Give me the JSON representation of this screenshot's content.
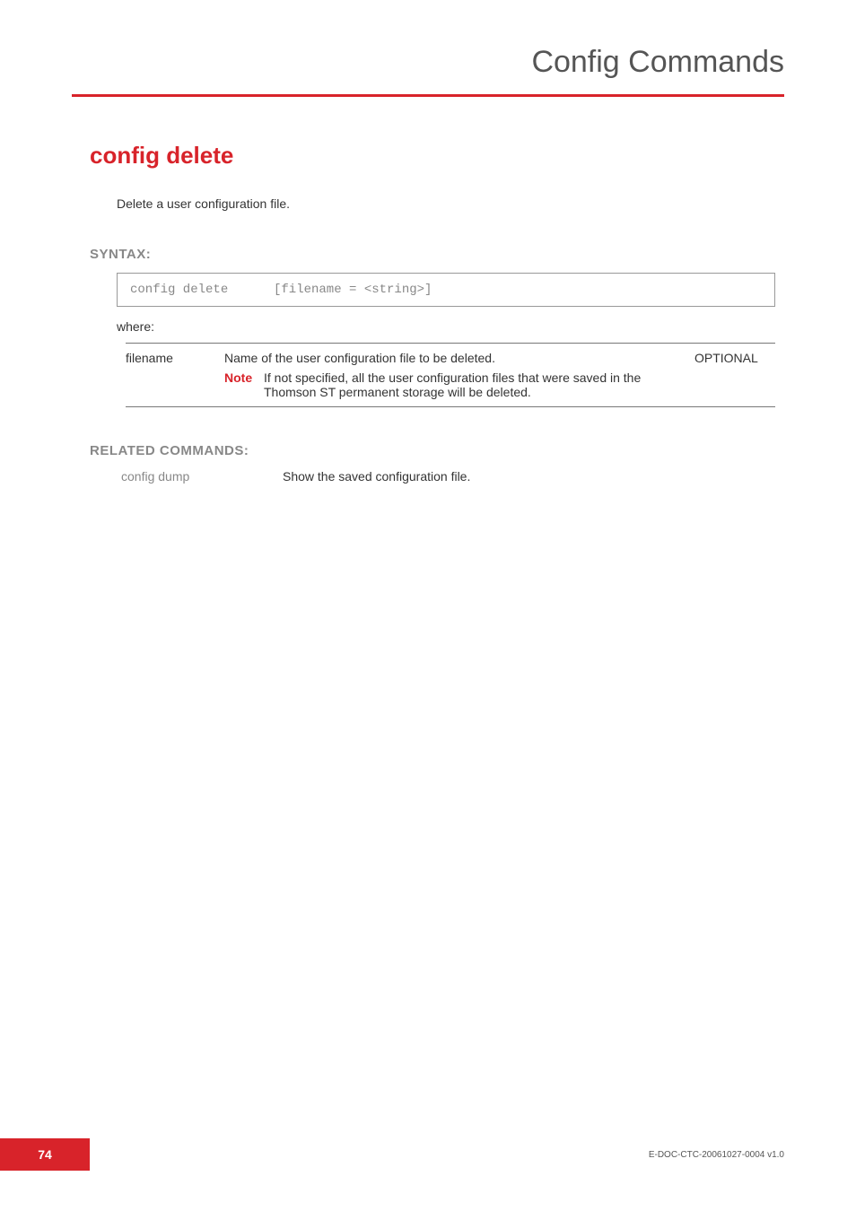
{
  "header": {
    "chapter_title": "Config Commands"
  },
  "command": {
    "title": "config delete",
    "description": "Delete a user configuration file."
  },
  "syntax": {
    "label": "SYNTAX:",
    "cmd": "config delete",
    "args": "[filename = <string>]"
  },
  "where_label": "where:",
  "param": {
    "name": "filename",
    "desc": "Name of the user configuration file to be deleted.",
    "optional": "OPTIONAL",
    "note_label": "Note",
    "note_text": "If not specified, all the user configuration files that were saved in the Thomson ST permanent storage will be deleted."
  },
  "related": {
    "label": "RELATED COMMANDS:",
    "cmd": "config dump",
    "desc": "Show the saved configuration file."
  },
  "footer": {
    "page": "74",
    "docid": "E-DOC-CTC-20061027-0004 v1.0"
  }
}
